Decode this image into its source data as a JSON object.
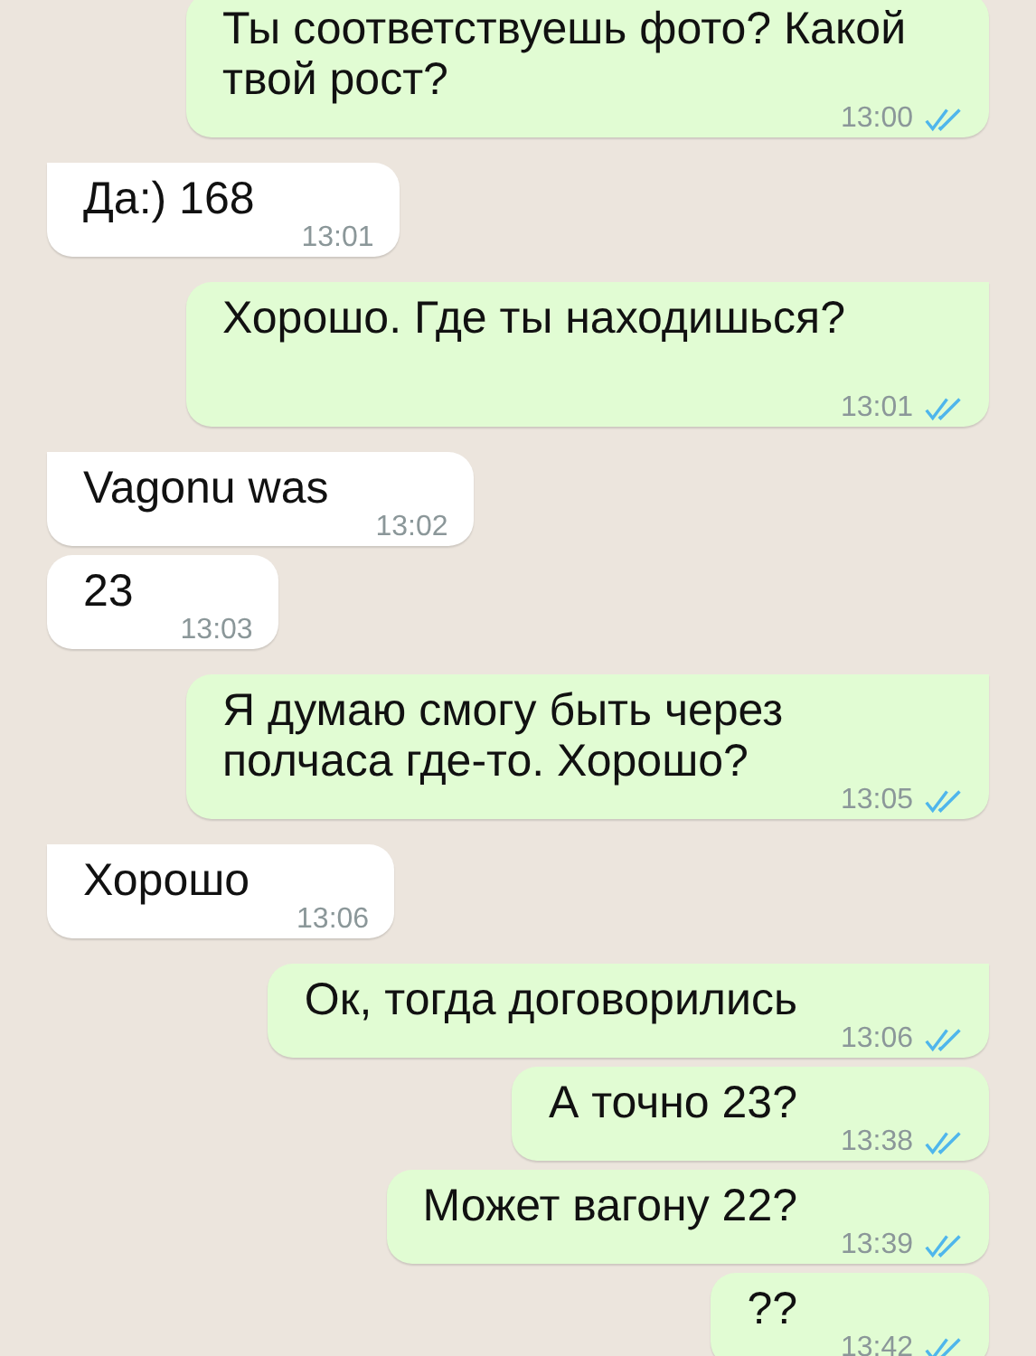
{
  "messages": [
    {
      "kind": "outgoing",
      "text": "Ты соответствуешь фото? Какой твой рост?",
      "time": "13:00",
      "read": true,
      "tail": false
    },
    {
      "kind": "incoming",
      "text": "Да:) 168",
      "time": "13:01",
      "tail": true
    },
    {
      "kind": "outgoing",
      "text": "Хорошо. Где ты находишься?",
      "time": "13:01",
      "read": true,
      "tail": true
    },
    {
      "kind": "incoming",
      "text": "Vagonu was",
      "time": "13:02",
      "tail": true
    },
    {
      "kind": "incoming",
      "text": "23",
      "time": "13:03",
      "tail": false
    },
    {
      "kind": "outgoing",
      "text": "Я думаю смогу быть через полчаса где-то. Хорошо?",
      "time": "13:05",
      "read": true,
      "tail": true
    },
    {
      "kind": "incoming",
      "text": "Хорошо",
      "time": "13:06",
      "tail": true
    },
    {
      "kind": "outgoing",
      "text": "Ок, тогда договорились",
      "time": "13:06",
      "read": true,
      "tail": true
    },
    {
      "kind": "outgoing",
      "text": "А точно 23?",
      "time": "13:38",
      "read": true,
      "tail": false
    },
    {
      "kind": "outgoing",
      "text": "Может вагону 22?",
      "time": "13:39",
      "read": true,
      "tail": false
    },
    {
      "kind": "outgoing",
      "text": "??",
      "time": "13:42",
      "read": true,
      "tail": false
    }
  ]
}
